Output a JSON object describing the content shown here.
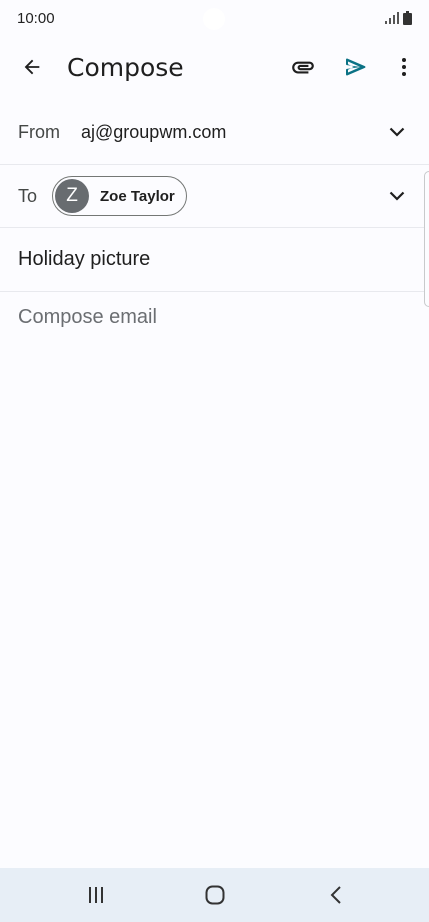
{
  "status_bar": {
    "time": "10:00",
    "icons": [
      "signal-icon",
      "battery-icon"
    ]
  },
  "app_bar": {
    "title": "Compose",
    "icons": [
      "back-arrow-icon",
      "attachment-icon",
      "send-icon",
      "more-vert-icon"
    ],
    "send_color": "#0b7285"
  },
  "form": {
    "from_label": "From",
    "from_value": "aj@groupwm.com",
    "to_label": "To",
    "recipient": {
      "initial": "Z",
      "name": "Zoe Taylor"
    },
    "subject": "Holiday picture",
    "body_placeholder": "Compose email"
  },
  "nav_bar": {
    "icons": [
      "recents-icon",
      "home-icon",
      "back-icon"
    ]
  }
}
